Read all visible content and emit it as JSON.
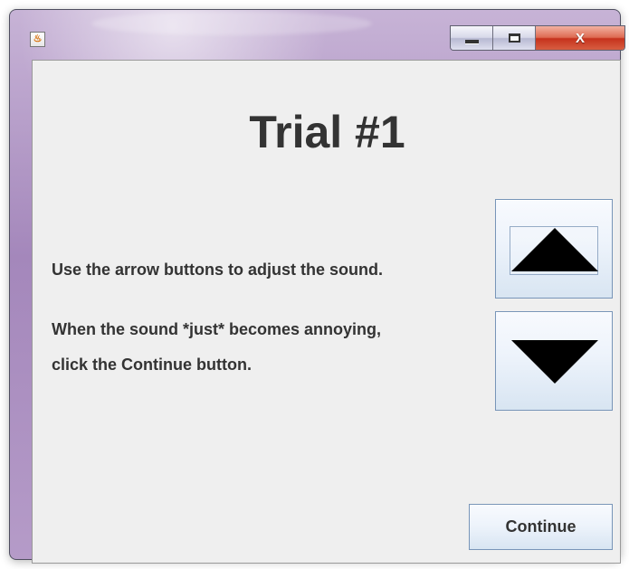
{
  "window": {
    "title": "",
    "app_icon": "java-icon",
    "controls": {
      "minimize_icon": "minimize-icon",
      "maximize_icon": "maximize-icon",
      "close_label": "X"
    }
  },
  "main": {
    "title": "Trial #1",
    "instructions": [
      "Use the arrow buttons to adjust the sound.",
      "When the sound *just* becomes annoying,",
      "click the Continue button."
    ],
    "buttons": {
      "up_icon": "triangle-up-icon",
      "down_icon": "triangle-down-icon",
      "continue_label": "Continue"
    }
  },
  "colors": {
    "title_bar": "#a487bb",
    "panel_background": "#efefef",
    "text": "#333333",
    "button_border": "#7895b8",
    "arrow": "#000000",
    "close_button": "#c6321d"
  }
}
